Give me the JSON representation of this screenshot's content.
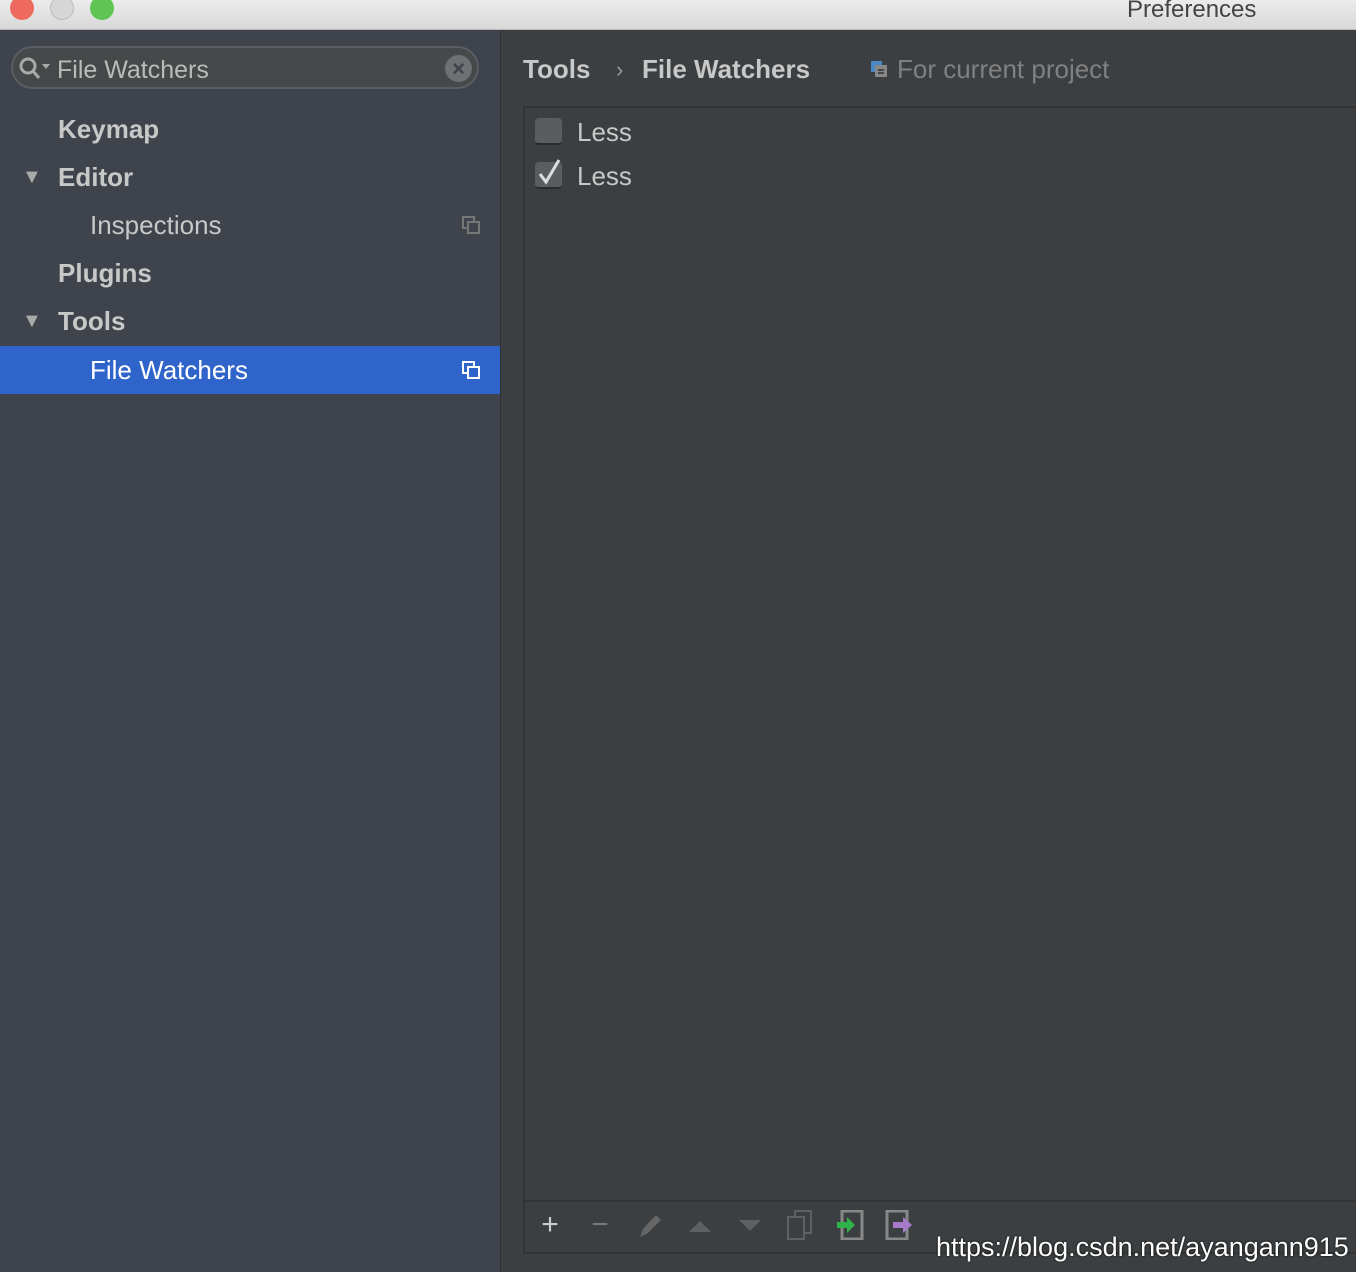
{
  "window": {
    "title": "Preferences"
  },
  "search": {
    "value": "File Watchers"
  },
  "sidebar": {
    "items": [
      {
        "label": "Keymap",
        "level": 0,
        "bold": true
      },
      {
        "label": "Editor",
        "level": 0,
        "bold": true,
        "expanded": true
      },
      {
        "label": "Inspections",
        "level": 1,
        "project_icon": true
      },
      {
        "label": "Plugins",
        "level": 0,
        "bold": true
      },
      {
        "label": "Tools",
        "level": 0,
        "bold": true,
        "expanded": true
      },
      {
        "label": "File Watchers",
        "level": 1,
        "selected": true,
        "project_icon": true
      }
    ]
  },
  "breadcrumb": {
    "parent": "Tools",
    "separator": "›",
    "current": "File Watchers",
    "scope": "For current project"
  },
  "watchers": [
    {
      "label": "Less",
      "checked": false
    },
    {
      "label": "Less",
      "checked": true
    }
  ],
  "toolbar": [
    "add-icon",
    "remove-icon",
    "edit-icon",
    "move-up-icon",
    "move-down-icon",
    "copy-icon",
    "import-icon",
    "export-icon"
  ],
  "watermark": "https://blog.csdn.net/ayangann915",
  "colors": {
    "selection": "#2f65ca",
    "sidebar": "#3e434c",
    "panel": "#3c3f41"
  }
}
